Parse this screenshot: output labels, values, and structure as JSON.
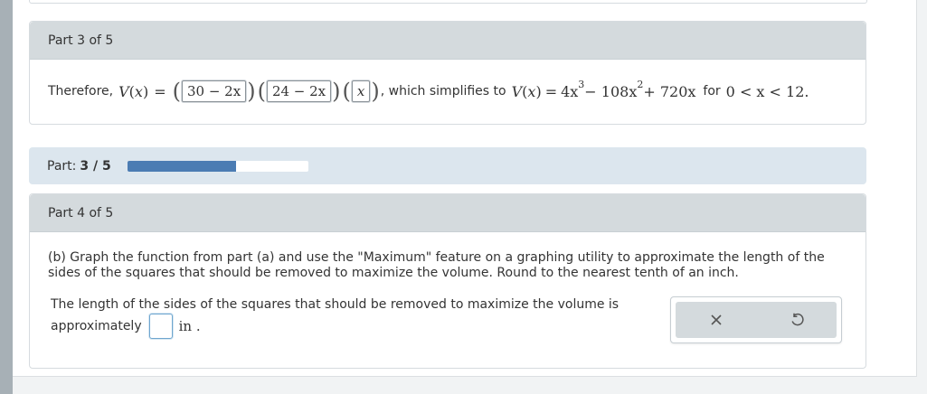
{
  "part3": {
    "header": "Part 3 of 5",
    "intro": "Therefore,",
    "lhs_fn": "V",
    "lhs_var": "x",
    "equals": "=",
    "answers": [
      "30 − 2x",
      "24 − 2x",
      "x"
    ],
    "simplifies_text": ", which simplifies to",
    "rhs_terms": [
      "4x",
      "3",
      " − 108x",
      "2",
      " + 720x"
    ],
    "domain_prefix": "for",
    "domain": "0 < x < 12."
  },
  "progress": {
    "label": "Part:",
    "value": "3 / 5",
    "fraction": 0.6
  },
  "part4": {
    "header": "Part 4 of 5",
    "question": "(b) Graph the function from part (a) and use the \"Maximum\" feature on a graphing utility to approximate the length of the sides of the squares that should be removed to maximize the volume. Round to the nearest tenth of an inch.",
    "answer_line": "The length of the sides of the squares that should be removed to maximize the volume is",
    "answer_prefix": "approximately",
    "answer_value": "",
    "unit": "in ."
  },
  "tools": {
    "clear_icon": "close-icon",
    "undo_icon": "undo-icon"
  }
}
